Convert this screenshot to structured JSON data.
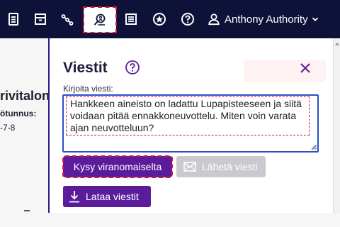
{
  "topbar": {
    "icons": [
      "document-list-icon",
      "archive-icon",
      "share-nodes-icon",
      "search-person-icon",
      "list-icon",
      "star-circle-icon",
      "help-circle-icon"
    ],
    "user": {
      "name": "Anthony Authority"
    },
    "colors": {
      "bar": "#0e1239",
      "active_bg": "#ffffff",
      "highlight": "#d7133a"
    }
  },
  "background_page": {
    "title_fragment": "rivitalon",
    "label_fragment": "ötunnus:",
    "value_fragment": "-7-8"
  },
  "dialog": {
    "title": "Viestit",
    "field_label": "Kirjoita viesti:",
    "message": "Hankkeen aineisto on ladattu Lupapisteeseen ja siitä voidaan pitää ennakkoneuvottelu. Miten voin varata ajan neuvotteluun?",
    "buttons": {
      "ask_authority": "Kysy viranomaiselta",
      "send_message": "Lähetä viesti",
      "upload_message": "Lataa viestit"
    },
    "colors": {
      "primary": "#5b1c9c",
      "disabled": "#c9c9cf",
      "focus_border": "#2b4fc9"
    }
  }
}
